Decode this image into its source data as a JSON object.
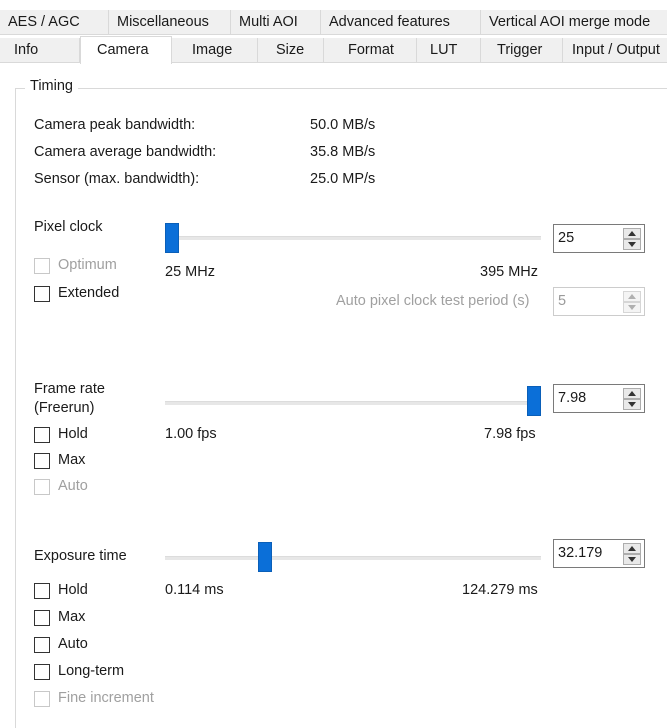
{
  "tabs_row1": [
    {
      "label": "AES / AGC"
    },
    {
      "label": "Miscellaneous"
    },
    {
      "label": "Multi AOI"
    },
    {
      "label": "Advanced features"
    },
    {
      "label": "Vertical AOI merge mode"
    }
  ],
  "tabs_row2": [
    {
      "label": "Info"
    },
    {
      "label": "Camera",
      "active": true
    },
    {
      "label": "Image"
    },
    {
      "label": "Size"
    },
    {
      "label": "Format"
    },
    {
      "label": "LUT"
    },
    {
      "label": "Trigger"
    },
    {
      "label": "Input / Output"
    }
  ],
  "timing": {
    "title": "Timing",
    "stats": [
      {
        "label": "Camera peak bandwidth:",
        "value": "50.0 MB/s"
      },
      {
        "label": "Camera average bandwidth:",
        "value": "35.8 MB/s"
      },
      {
        "label": "Sensor (max. bandwidth):",
        "value": "25.0 MP/s"
      }
    ]
  },
  "pixel_clock": {
    "label": "Pixel clock",
    "min_label": "25 MHz",
    "max_label": "395 MHz",
    "min": 25,
    "max": 395,
    "value": 25,
    "spin_value": "25",
    "checkboxes": [
      {
        "label": "Optimum",
        "checked": false,
        "disabled": true
      },
      {
        "label": "Extended",
        "checked": false,
        "disabled": false
      }
    ],
    "test_period_label": "Auto pixel clock test period (s)",
    "test_period_value": "5"
  },
  "frame_rate": {
    "label_line1": "Frame rate",
    "label_line2": "(Freerun)",
    "min_label": "1.00 fps",
    "max_label": "7.98 fps",
    "min": 1.0,
    "max": 7.98,
    "value": 7.98,
    "spin_value": "7.98",
    "checkboxes": [
      {
        "label": "Hold",
        "checked": false,
        "disabled": false
      },
      {
        "label": "Max",
        "checked": false,
        "disabled": false
      },
      {
        "label": "Auto",
        "checked": false,
        "disabled": true
      }
    ]
  },
  "exposure": {
    "label": "Exposure time",
    "min_label": "0.114 ms",
    "max_label": "124.279 ms",
    "min": 0.114,
    "max": 124.279,
    "value": 32.179,
    "spin_value": "32.179",
    "checkboxes": [
      {
        "label": "Hold",
        "checked": false,
        "disabled": false
      },
      {
        "label": "Max",
        "checked": false,
        "disabled": false
      },
      {
        "label": "Auto",
        "checked": false,
        "disabled": false
      },
      {
        "label": "Long-term",
        "checked": false,
        "disabled": false
      },
      {
        "label": "Fine increment",
        "checked": false,
        "disabled": true
      }
    ]
  },
  "colors": {
    "accent": "#0b6fd8",
    "tab_bg": "#f0f0f0",
    "disabled_text": "#a0a0a0"
  }
}
